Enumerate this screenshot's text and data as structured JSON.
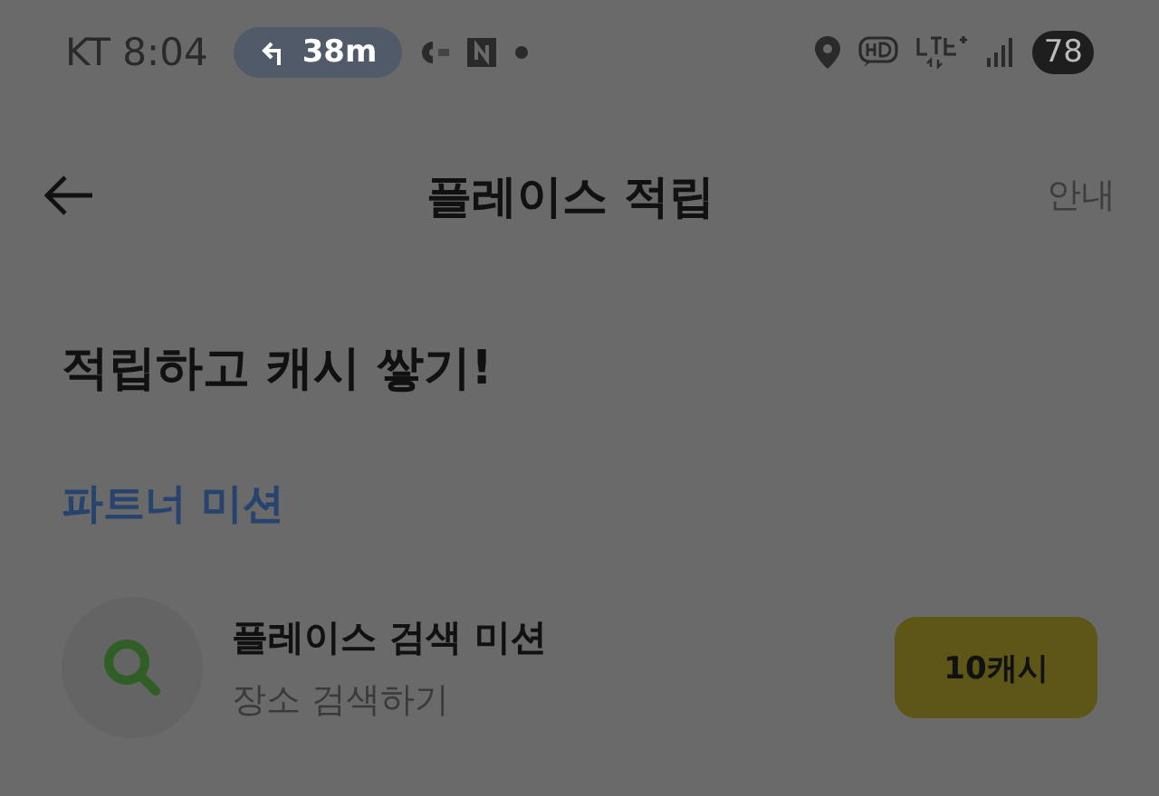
{
  "status_bar": {
    "carrier": "KT",
    "time": "8:04",
    "nav_distance": "38m",
    "battery": "78"
  },
  "header": {
    "title": "플레이스 적립",
    "action": "안내"
  },
  "headline": "적립하고 캐시 쌓기!",
  "section_title": "파트너 미션",
  "missions": [
    {
      "title": "플레이스 검색 미션",
      "subtitle": "장소 검색하기",
      "reward": "10캐시"
    }
  ]
}
